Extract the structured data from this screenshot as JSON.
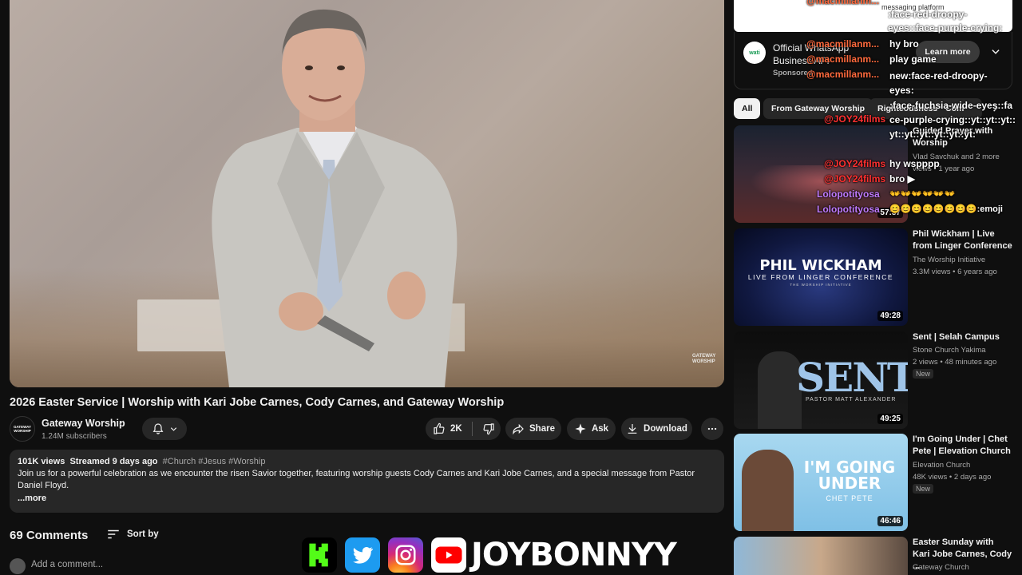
{
  "video": {
    "title": "2026 Easter Service | Worship with Kari Jobe Carnes, Cody Carnes, and Gateway Worship",
    "watermark": "GATEWAY WORSHIP"
  },
  "channel": {
    "avatar_text": "GATEWAY WORSHIP",
    "name": "Gateway Worship",
    "verified": "✓",
    "subscribers": "1.24M subscribers"
  },
  "actions": {
    "likes": "2K",
    "share": "Share",
    "ask": "Ask",
    "download": "Download"
  },
  "description": {
    "views": "101K views",
    "streamed": "Streamed 9 days ago",
    "tags": "#Church #Jesus #Worship",
    "text": "Join us for a powerful celebration as we encounter the risen Savior together, featuring worship guests Cody Carnes and Kari Jobe Carnes, and a special message from Pastor Daniel Floyd.",
    "more": "...more"
  },
  "comments": {
    "count": "69 Comments",
    "sort": "Sort by",
    "placeholder": "Add a comment..."
  },
  "overlay": {
    "name": "JOYBONNYY",
    "icons": [
      "kick-icon",
      "twitter-icon",
      "instagram-icon",
      "youtube-icon"
    ]
  },
  "ad": {
    "logo": "wati",
    "title": "Official WhatsApp Business API",
    "sponsored": "Sponsored",
    "learn_more": "Learn more",
    "top_text": "messaging platform"
  },
  "chips": [
    "All",
    "From Gateway Worship",
    "Righteousness",
    "Com"
  ],
  "recommended": [
    {
      "title": "Guided Prayer with Worship",
      "channel": "Vlad Savchuk",
      "extra": "and 2 more",
      "meta": "views • 1 year ago",
      "duration": "57:37",
      "is_new": false
    },
    {
      "title": "Phil Wickham | Live from Linger Conference",
      "channel": "The Worship Initiative",
      "meta": "3.3M views • 6 years ago",
      "duration": "49:28",
      "thumb_title": "PHIL WICKHAM",
      "thumb_sub": "LIVE FROM LINGER CONFERENCE",
      "thumb_small": "THE WORSHIP INITIATIVE",
      "is_new": false
    },
    {
      "title": "Sent | Selah Campus",
      "channel": "Stone Church Yakima",
      "meta": "2 views • 48 minutes ago",
      "duration": "49:25",
      "thumb_title": "SENT",
      "thumb_sub": "PASTOR MATT ALEXANDER",
      "is_new": true,
      "new_label": "New"
    },
    {
      "title": "I'm Going Under | Chet Pete | Elevation Church",
      "channel": "Elevation Church",
      "meta": "48K views • 2 days ago",
      "duration": "46:46",
      "thumb_title": "I'M GOING UNDER",
      "thumb_sub": "CHET PETE",
      "is_new": true,
      "new_label": "New"
    },
    {
      "title": "Easter Sunday with Kari Jobe Carnes, Cody ...",
      "channel": "Gateway Church",
      "meta": "",
      "duration": "",
      "is_new": false
    }
  ],
  "chat": [
    {
      "user": "@macmillanm...",
      "msg": "hy bro",
      "color": "orange"
    },
    {
      "user": "@macmillanm...",
      "msg": "play game",
      "color": "orange"
    },
    {
      "user": "@macmillanm...",
      "msg": "new:face-red-droopy-eyes:",
      "color": "orange"
    },
    {
      "user": "@JOY24films",
      "msg": ":face-fuchsia-wide-eyes::face-purple-crying::yt::yt::yt::yt::yt::yt::yt::yt::yt:",
      "color": "red"
    },
    {
      "user": "@JOY24films",
      "msg": "hy wspppp",
      "color": "red"
    },
    {
      "user": "@JOY24films",
      "msg": "bro ▶",
      "color": "red"
    },
    {
      "user": "Lolopotityosa",
      "msg": "👐👐👐👐👐👐",
      "color": "purple"
    },
    {
      "user": "Lolopotityosa",
      "msg": "😊😊😊😊😊😊😊😊:emoji",
      "color": "purple"
    }
  ],
  "chat_top": [
    {
      "user": "@macmillanm...",
      "msg": ":face-red-droopy-eyes::face-purple-crying:"
    }
  ],
  "colors": {
    "background": "#0f0f0f",
    "surface": "#272727",
    "text": "#f1f1f1",
    "muted": "#aaaaaa"
  }
}
